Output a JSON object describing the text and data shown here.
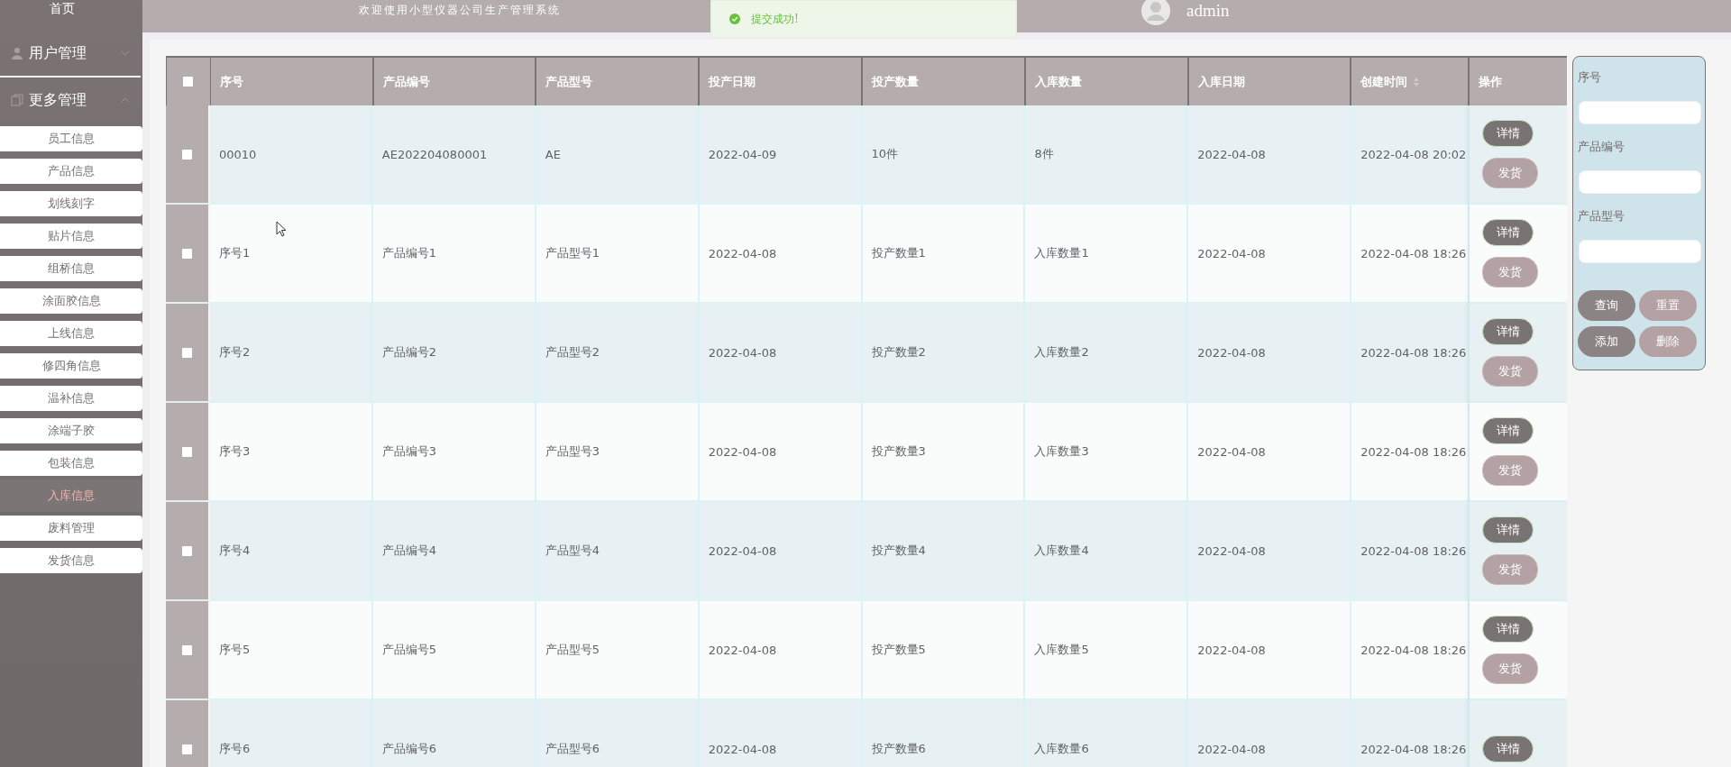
{
  "sidebar": {
    "home": "首页",
    "groups": [
      {
        "label": "用户管理",
        "expanded": false
      },
      {
        "label": "更多管理",
        "expanded": true
      }
    ],
    "items": [
      {
        "label": "员工信息",
        "selected": false
      },
      {
        "label": "产品信息",
        "selected": false
      },
      {
        "label": "划线刻字",
        "selected": false
      },
      {
        "label": "贴片信息",
        "selected": false
      },
      {
        "label": "组桥信息",
        "selected": false
      },
      {
        "label": "涂面胶信息",
        "selected": false
      },
      {
        "label": "上线信息",
        "selected": false
      },
      {
        "label": "修四角信息",
        "selected": false
      },
      {
        "label": "温补信息",
        "selected": false
      },
      {
        "label": "涂端子胶",
        "selected": false
      },
      {
        "label": "包装信息",
        "selected": false
      },
      {
        "label": "入库信息",
        "selected": true
      },
      {
        "label": "废料管理",
        "selected": false
      },
      {
        "label": "发货信息",
        "selected": false
      }
    ]
  },
  "header": {
    "title": "欢迎使用小型仪器公司生产管理系统",
    "user": "admin"
  },
  "toast": {
    "message": "提交成功!"
  },
  "table": {
    "select_all_checked": false,
    "columns": [
      "序号",
      "产品编号",
      "产品型号",
      "投产日期",
      "投产数量",
      "入库数量",
      "入库日期",
      "创建时间",
      "操作"
    ],
    "rows": [
      {
        "checked": false,
        "cells": [
          "00010",
          "AE202204080001",
          "AE",
          "2022-04-09",
          "10件",
          "8件",
          "2022-04-08",
          "2022-04-08 20:02"
        ],
        "actions": [
          "详情",
          "发货"
        ]
      },
      {
        "checked": false,
        "cells": [
          "序号1",
          "产品编号1",
          "产品型号1",
          "2022-04-08",
          "投产数量1",
          "入库数量1",
          "2022-04-08",
          "2022-04-08 18:26"
        ],
        "actions": [
          "详情",
          "发货"
        ]
      },
      {
        "checked": false,
        "cells": [
          "序号2",
          "产品编号2",
          "产品型号2",
          "2022-04-08",
          "投产数量2",
          "入库数量2",
          "2022-04-08",
          "2022-04-08 18:26"
        ],
        "actions": [
          "详情",
          "发货"
        ]
      },
      {
        "checked": false,
        "cells": [
          "序号3",
          "产品编号3",
          "产品型号3",
          "2022-04-08",
          "投产数量3",
          "入库数量3",
          "2022-04-08",
          "2022-04-08 18:26"
        ],
        "actions": [
          "详情",
          "发货"
        ]
      },
      {
        "checked": false,
        "cells": [
          "序号4",
          "产品编号4",
          "产品型号4",
          "2022-04-08",
          "投产数量4",
          "入库数量4",
          "2022-04-08",
          "2022-04-08 18:26"
        ],
        "actions": [
          "详情",
          "发货"
        ]
      },
      {
        "checked": false,
        "cells": [
          "序号5",
          "产品编号5",
          "产品型号5",
          "2022-04-08",
          "投产数量5",
          "入库数量5",
          "2022-04-08",
          "2022-04-08 18:26"
        ],
        "actions": [
          "详情",
          "发货"
        ]
      },
      {
        "checked": false,
        "cells": [
          "序号6",
          "产品编号6",
          "产品型号6",
          "2022-04-08",
          "投产数量6",
          "入库数量6",
          "2022-04-08",
          "2022-04-08 18:26"
        ],
        "actions": [
          "详情"
        ]
      }
    ]
  },
  "search": {
    "fields": [
      {
        "label": "序号"
      },
      {
        "label": "产品编号"
      },
      {
        "label": "产品型号"
      }
    ],
    "buttons": [
      {
        "label": "查询",
        "kind": "dark"
      },
      {
        "label": "重置",
        "kind": "light"
      },
      {
        "label": "添加",
        "kind": "dark"
      },
      {
        "label": "删除",
        "kind": "light"
      }
    ]
  }
}
